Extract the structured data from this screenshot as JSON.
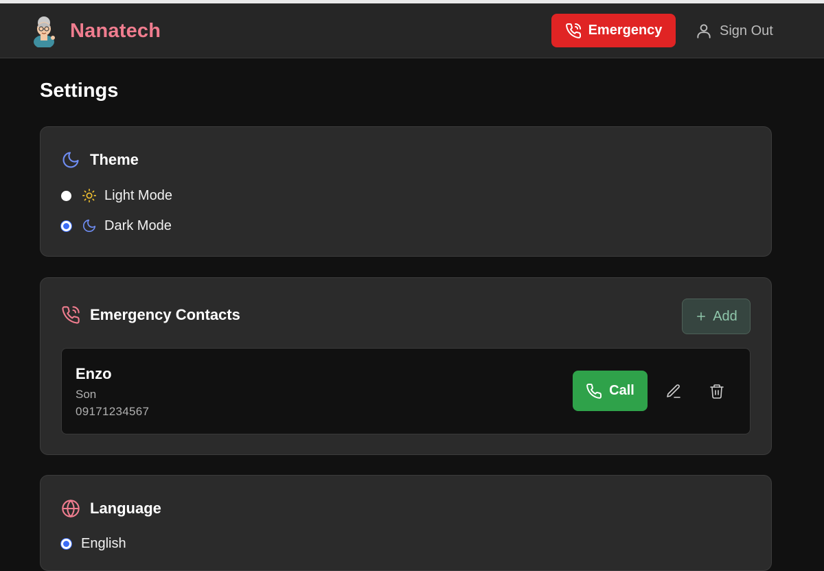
{
  "header": {
    "brand_name": "Nanatech",
    "emergency_label": "Emergency",
    "signout_label": "Sign Out"
  },
  "page": {
    "title": "Settings"
  },
  "theme": {
    "heading": "Theme",
    "options": [
      {
        "label": "Light Mode",
        "selected": false,
        "icon": "sun-icon"
      },
      {
        "label": "Dark Mode",
        "selected": true,
        "icon": "moon-icon"
      }
    ]
  },
  "contacts": {
    "heading": "Emergency Contacts",
    "add_label": "Add",
    "items": [
      {
        "name": "Enzo",
        "relation": "Son",
        "phone": "09171234567",
        "call_label": "Call"
      }
    ]
  },
  "language": {
    "heading": "Language",
    "options": [
      {
        "label": "English",
        "selected": true
      }
    ]
  },
  "colors": {
    "brand": "#f07d8f",
    "emergency": "#e02424",
    "call": "#2fa24a",
    "accent_blue": "#3b6cf6",
    "moon_icon": "#6f8df3",
    "sun_icon": "#f2c230"
  }
}
